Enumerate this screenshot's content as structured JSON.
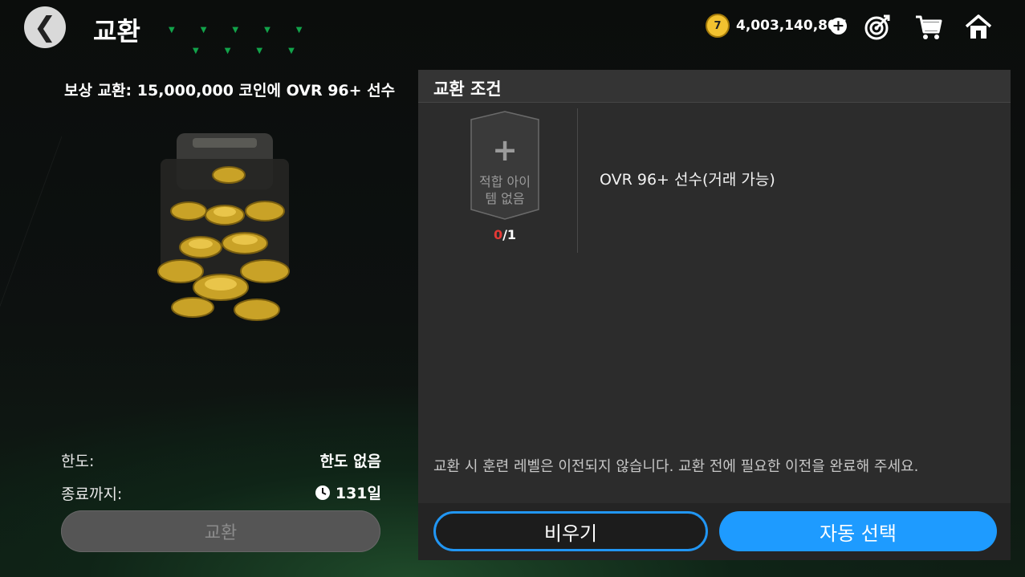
{
  "header": {
    "back_label": "❮",
    "title": "교환",
    "coin_icon_label": "7",
    "coin_balance": "4,003,140,807",
    "add_coins_label": "+",
    "icons": [
      "target-icon",
      "cart-icon",
      "home-icon"
    ]
  },
  "reward": {
    "caption": "보상 교환: 15,000,000 코인에 OVR 96+ 선수",
    "image": "coins-bag-image"
  },
  "info": {
    "limit_label": "한도:",
    "limit_value": "한도 없음",
    "end_label": "종료까지:",
    "end_value": "131일"
  },
  "exchange_button": "교환",
  "panel": {
    "title": "교환 조건",
    "slot_plus": "+",
    "slot_empty_line1": "적합 아이",
    "slot_empty_line2": "템 없음",
    "slot_count_have": "0",
    "slot_count_total": "/1",
    "requirement": "OVR 96+ 선수(거래 가능)",
    "notice": "교환 시 훈련 레벨은 이전되지 않습니다. 교환 전에 필요한 이전을 완료해 주세요.",
    "clear_button": "비우기",
    "auto_button": "자동 선택"
  },
  "colors": {
    "accent_blue": "#1e9bff",
    "count_red": "#e53935",
    "coin_gold": "#f2c230"
  }
}
